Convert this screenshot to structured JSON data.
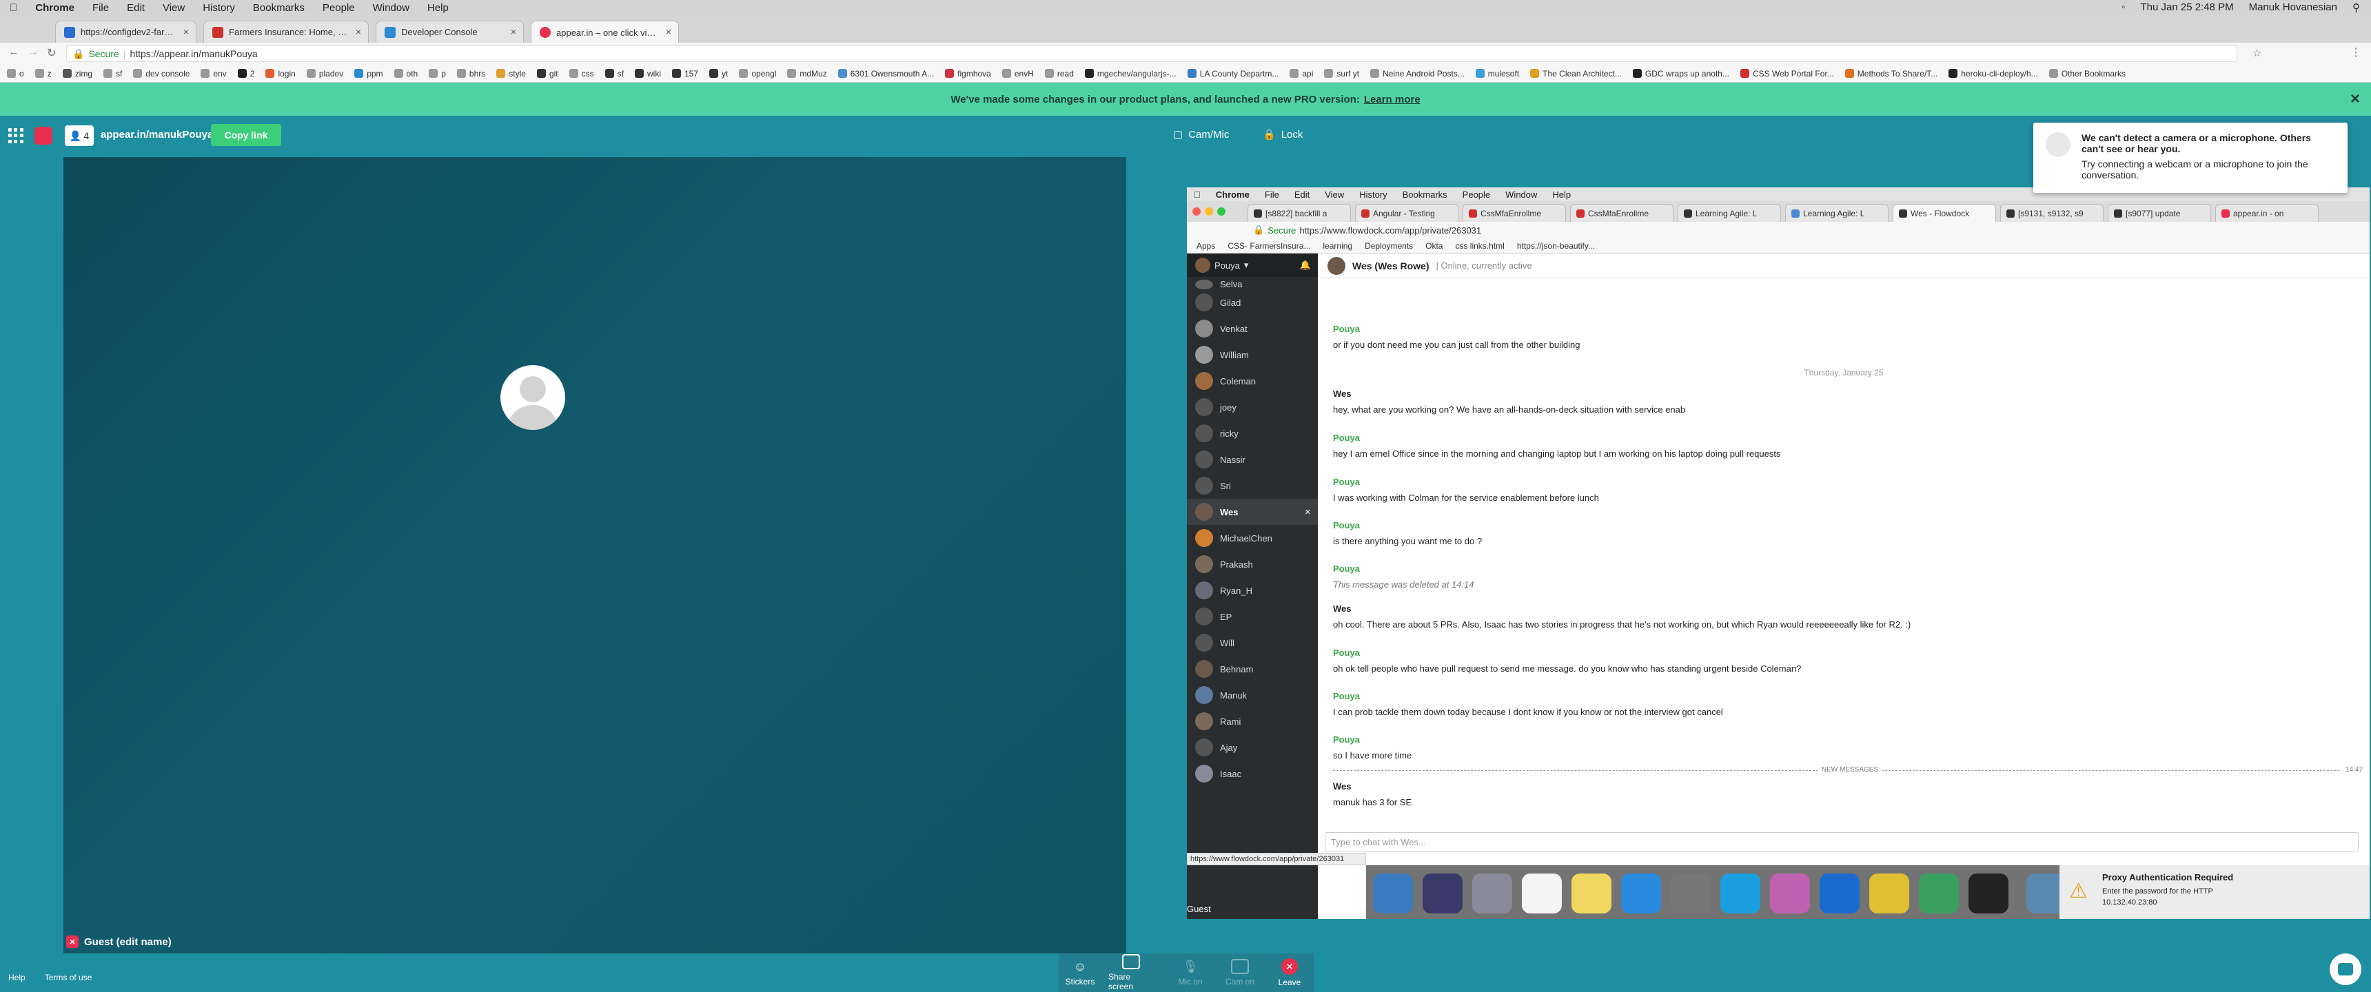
{
  "menubar": {
    "app": "Chrome",
    "items": [
      "File",
      "Edit",
      "View",
      "History",
      "Bookmarks",
      "People",
      "Window",
      "Help"
    ],
    "clock": "Thu Jan 25  2:48 PM",
    "user": "Manuk Hovanesian"
  },
  "tabs": [
    {
      "label": "https://configdev2-farmers.m",
      "color": "#2b6cd0"
    },
    {
      "label": "Farmers Insurance: Home, Life",
      "color": "#d0302b"
    },
    {
      "label": "Developer Console",
      "color": "#2b8ad0"
    },
    {
      "label": "appear.in – one click video",
      "color": "#e8304e",
      "active": true
    }
  ],
  "address": {
    "secure_label": "Secure",
    "url": "https://appear.in/manukPouya"
  },
  "bookmarks": [
    "o",
    "z",
    "zimg",
    "sf",
    "dev console",
    "env",
    "2",
    "login",
    "pladev",
    "ppm",
    "oth",
    "p",
    "bhrs",
    "style",
    "git",
    "css",
    "sf",
    "wiki",
    "157",
    "yt",
    "opengl",
    "mdMuz",
    "6301 Owensmouth A...",
    "figmhova",
    "envH",
    "read",
    "mgechev/angularjs-...",
    "LA County Departm...",
    "api",
    "surf yt",
    "Neine Android Posts...",
    "mulesoft",
    "The Clean Architect...",
    "GDC wraps up anoth...",
    "CSS Web Portal For...",
    "Methods To Share/T...",
    "heroku-cli-deploy/h...",
    "Other Bookmarks"
  ],
  "banner": {
    "text": "We've made some changes in our product plans, and launched a new PRO version:",
    "link": "Learn more"
  },
  "appbar": {
    "people_count": "4",
    "room": "appear.in/manukPouya",
    "copy_label": "Copy link",
    "cammic_label": "Cam/Mic",
    "lock_label": "Lock"
  },
  "alert": {
    "title": "We can't detect a camera or a microphone. Others can't see or hear you.",
    "body": "Try connecting a webcam or a microphone to join the conversation."
  },
  "guest_label": "Guest (edit name)",
  "share": {
    "menubar": [
      "Chrome",
      "File",
      "Edit",
      "View",
      "History",
      "Bookmarks",
      "People",
      "Window",
      "Help"
    ],
    "tabs": [
      "[s8822] backfill a",
      "Angular - Testing",
      "CssMfaEnrollme",
      "CssMfaEnrollme",
      "Learning Agile: L",
      "Learning Agile: L",
      "Wes - Flowdock",
      "[s9131, s9132, s9",
      "[s9077] update",
      "appear.in - on"
    ],
    "address_secure": "Secure",
    "address_url": "https://www.flowdock.com/app/private/263031",
    "bookmarks": [
      "Apps",
      "CSS- FarmersInsura...",
      "learning",
      "Deployments",
      "Okta",
      "css links.html",
      "https://json-beautify..."
    ],
    "user": "Pouya",
    "contacts": [
      "Selva",
      "Gilad",
      "Venkat",
      "William",
      "Coleman",
      "joey",
      "ricky",
      "Nassir",
      "Sri",
      "Wes",
      "MichaelChen",
      "Prakash",
      "Ryan_H",
      "EP",
      "Will",
      "Behnam",
      "Manuk",
      "Rami",
      "Ajay",
      "Isaac"
    ],
    "header_name": "Wes (Wes Rowe)",
    "header_status": "| Online, currently active",
    "day_separator": "Thursday, January 25",
    "messages": [
      {
        "who": "Pouya",
        "text": "or if you dont need me you can just call from the other building"
      },
      {
        "who": "Wes",
        "text": "hey, what are you working on? We have an all-hands-on-deck situation with service enab"
      },
      {
        "who": "Pouya",
        "text": "hey I am ernel Office since in the morning and changing laptop but I am working on his laptop doing pull requests"
      },
      {
        "who": "Pouya",
        "text": "I was working with Colman for the service enablement before lunch"
      },
      {
        "who": "Pouya",
        "text": "is there anything you want me to do ?"
      },
      {
        "who": "Pouya",
        "text": "This message was deleted at 14:14",
        "deleted": true
      },
      {
        "who": "Wes",
        "text": "oh cool. There are about 5 PRs. Also, Isaac has two stories in progress that he's not working on, but which Ryan would reeeeeeeally like for R2. :)"
      },
      {
        "who": "Pouya",
        "text": "oh ok tell people who have pull request to send me message. do you know who has standing urgent beside Coleman?"
      },
      {
        "who": "Pouya",
        "text": "I can prob tackle them down today because I dont know if you know or not the interview got cancel"
      },
      {
        "who": "Pouya",
        "text": "so I have more time"
      },
      {
        "who": "Wes",
        "text": "manuk has 3 for SE"
      }
    ],
    "new_messages_label": "NEW MESSAGES",
    "new_messages_time": "14:47",
    "input_placeholder": "Type to chat with Wes...",
    "status_url": "https://www.flowdock.com/app/private/263031",
    "proxy_title": "Proxy Authentication Required",
    "proxy_body": "Enter the password for the HTTP",
    "proxy_addr": "10.132.40.23:80",
    "guest": "Guest"
  },
  "controls": {
    "stickers": "Stickers",
    "share": "Share screen",
    "mic": "Mic on",
    "cam": "Cam on",
    "leave": "Leave"
  },
  "footer": {
    "help": "Help",
    "terms": "Terms of use"
  }
}
